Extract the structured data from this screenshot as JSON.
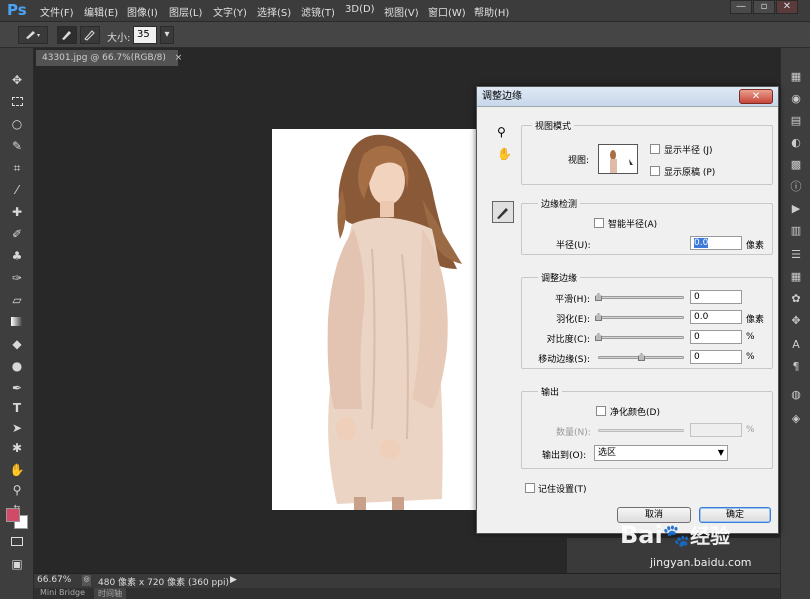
{
  "app": {
    "logo": "Ps"
  },
  "menu": [
    "文件(F)",
    "编辑(E)",
    "图像(I)",
    "图层(L)",
    "文字(Y)",
    "选择(S)",
    "滤镜(T)",
    "3D(D)",
    "视图(V)",
    "窗口(W)",
    "帮助(H)"
  ],
  "window_controls": {
    "minimize": "—",
    "restore": "▫",
    "close": "✕"
  },
  "options_bar": {
    "size_label": "大小:",
    "size_value": "35",
    "dropdown": "▾"
  },
  "document": {
    "tab_title": "43301.jpg @ 66.7%(RGB/8)",
    "tab_close": "×"
  },
  "status": {
    "zoom": "66.67%",
    "doc_info": "480 像素 x 720 像素 (360 ppi)",
    "arrow": "▶"
  },
  "bottom_tabs": [
    "Mini Bridge",
    "时间轴"
  ],
  "dialog": {
    "title": "调整边缘",
    "close": "✕",
    "view_mode": {
      "title": "视图模式",
      "view_label": "视图:",
      "show_radius": "显示半径 (J)",
      "show_original": "显示原稿 (P)"
    },
    "edge_detection": {
      "title": "边缘检测",
      "smart_radius": "智能半径(A)",
      "radius_label": "半径(U):",
      "radius_value": "0.0",
      "radius_unit": "像素"
    },
    "adjust_edge": {
      "title": "调整边缘",
      "rows": [
        {
          "label": "平滑(H):",
          "value": "0",
          "unit": "",
          "pos": 0
        },
        {
          "label": "羽化(E):",
          "value": "0.0",
          "unit": "像素",
          "pos": 0
        },
        {
          "label": "对比度(C):",
          "value": "0",
          "unit": "%",
          "pos": 0
        },
        {
          "label": "移动边缘(S):",
          "value": "0",
          "unit": "%",
          "pos": 0.5
        }
      ]
    },
    "output": {
      "title": "输出",
      "decontaminate": "净化颜色(D)",
      "amount_label": "数量(N):",
      "amount_unit": "%",
      "output_to_label": "输出到(O):",
      "output_to_value": "选区"
    },
    "remember": "记住设置(T)",
    "cancel": "取消",
    "ok": "确定"
  },
  "watermark": {
    "brand": "Bai",
    "brand2": "经验",
    "url": "jingyan.baidu.com"
  },
  "colors": {
    "foreground": "#d14a67",
    "background": "#ffffff",
    "accent": "#4aa3f5"
  }
}
